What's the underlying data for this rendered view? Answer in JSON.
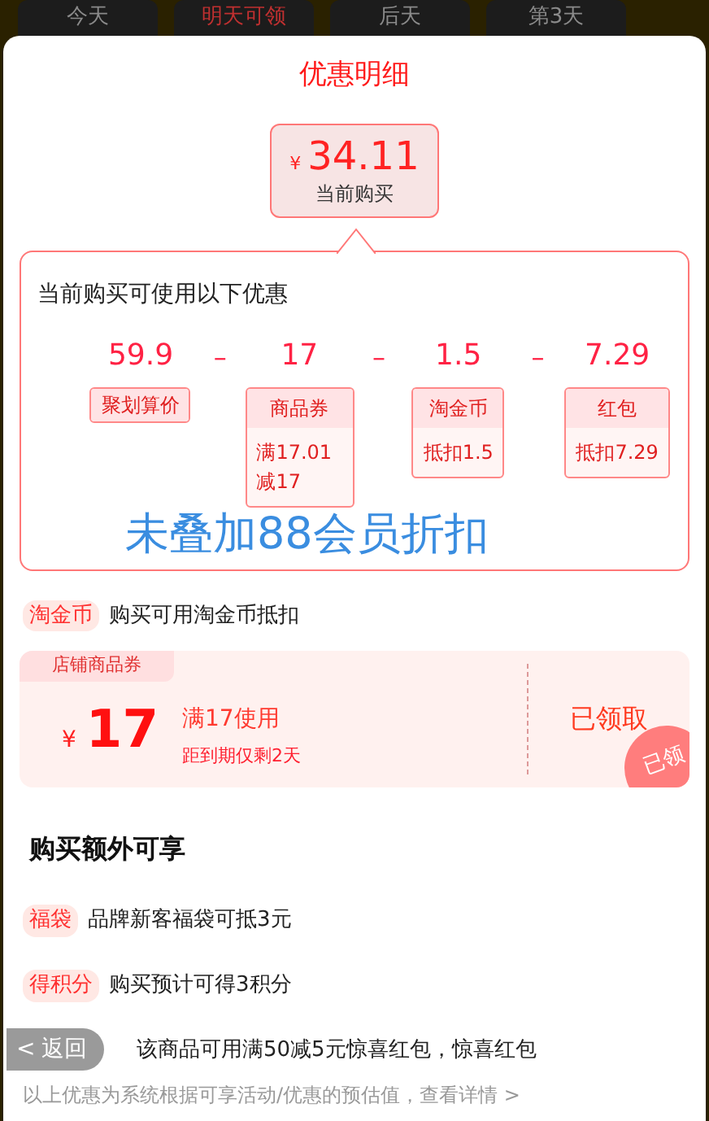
{
  "day_tabs": [
    {
      "label": "今天",
      "selected": false
    },
    {
      "label": "明天可领",
      "selected": true
    },
    {
      "label": "后天",
      "selected": false
    },
    {
      "label": "第3天",
      "selected": false
    }
  ],
  "sheet": {
    "title": "优惠明细",
    "price": {
      "currency": "¥",
      "amount": "34.11",
      "caption": "当前购买"
    },
    "breakdown": {
      "heading": "当前购买可使用以下优惠",
      "items": [
        {
          "value": "59.9",
          "tag": "聚划算价"
        },
        {
          "operator": "–",
          "value": "17",
          "tag": "商品券",
          "detail": "满17.01减17"
        },
        {
          "operator": "–",
          "value": "1.5",
          "tag": "淘金币",
          "detail": "抵扣1.5"
        },
        {
          "operator": "–",
          "value": "7.29",
          "tag": "红包",
          "detail": "抵扣7.29"
        }
      ],
      "note": "未叠加88会员折扣"
    },
    "coin_row": {
      "tag": "淘金币",
      "text": "购买可用淘金币抵扣"
    },
    "coupon": {
      "label": "店铺商品券",
      "currency": "¥",
      "amount": "17",
      "condition": "满17使用",
      "expiry": "距到期仅剩2天",
      "status": "已领取",
      "stamp": "已领",
      "claimed": true
    },
    "extras": {
      "heading": "购买额外可享",
      "items": [
        {
          "tag": "福袋",
          "text": "品牌新客福袋可抵3元"
        },
        {
          "tag": "得积分",
          "text": "购买预计可得3积分"
        },
        {
          "text": "该商品可用满50减5元惊喜红包，惊喜红包"
        }
      ]
    },
    "back_button": {
      "icon": "<",
      "label": "返回"
    },
    "footer": "以上优惠为系统根据可享活动/优惠的预估值，查看详情 >"
  }
}
